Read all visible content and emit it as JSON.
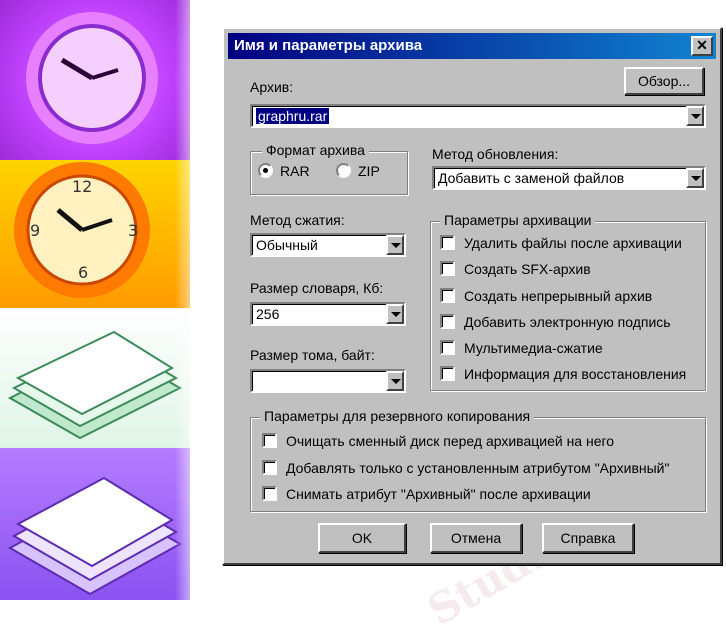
{
  "dialog": {
    "title": "Имя и параметры архива",
    "close_glyph": "✕",
    "archive_label": "Архив:",
    "browse_label": "Обзор...",
    "archive_value": "graphru.rar",
    "format_group": {
      "legend": "Формат архива",
      "options": [
        {
          "label": "RAR",
          "checked": true
        },
        {
          "label": "ZIP",
          "checked": false
        }
      ]
    },
    "update_method": {
      "label": "Метод обновления:",
      "value": "Добавить с заменой файлов"
    },
    "compression": {
      "label": "Метод сжатия:",
      "value": "Обычный"
    },
    "dictionary": {
      "label": "Размер словаря, Кб:",
      "value": "256"
    },
    "volume": {
      "label": "Размер тома, байт:",
      "value": ""
    },
    "archive_params": {
      "legend": "Параметры архивации",
      "items": [
        "Удалить файлы после архивации",
        "Создать SFX-архив",
        "Создать непрерывный архив",
        "Добавить электронную подпись",
        "Мультимедиа-сжатие",
        "Информация для восстановления"
      ]
    },
    "backup_params": {
      "legend": "Параметры для резервного копирования",
      "items": [
        "Очищать сменный диск перед архивацией на него",
        "Добавлять только с установленным атрибутом \"Архивный\"",
        "Снимать атрибут \"Архивный\" после архивации"
      ]
    },
    "buttons": {
      "ok": "OK",
      "cancel": "Отмена",
      "help": "Справка"
    }
  },
  "watermark": "Stud.kz",
  "colors": {
    "dialog_face": "#c0c0c0",
    "title_start": "#000080",
    "title_end": "#1084d0",
    "selection": "#000080"
  }
}
